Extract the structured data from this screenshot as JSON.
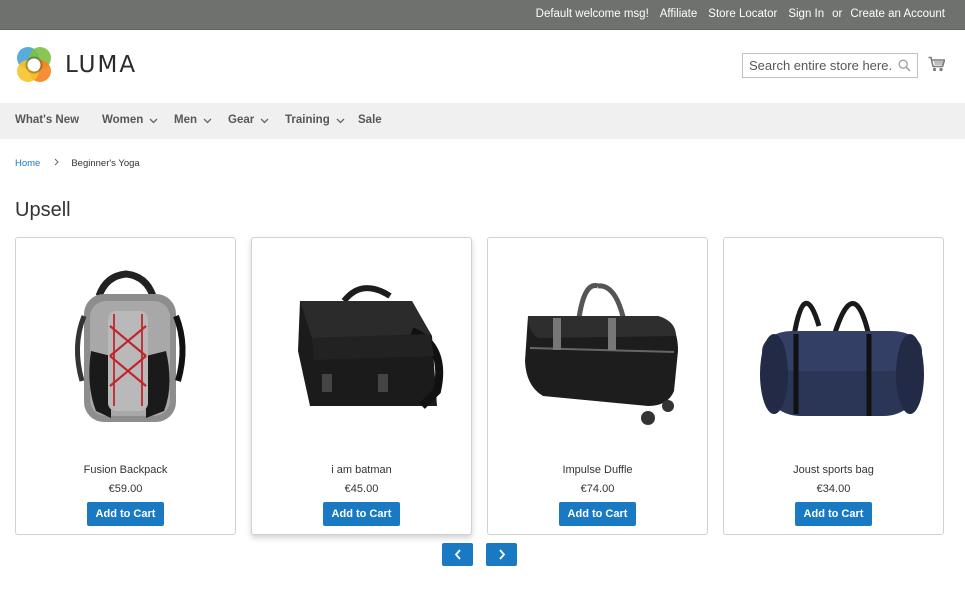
{
  "topbar": {
    "welcome": "Default welcome msg!",
    "affiliate": "Affiliate",
    "store_locator": "Store Locator",
    "sign_in": "Sign In",
    "or": "or",
    "create_account": "Create an Account"
  },
  "header": {
    "logo_text": "LUMA",
    "search_placeholder": "Search entire store here..."
  },
  "nav": {
    "items": [
      {
        "label": "What's New",
        "has_dropdown": false
      },
      {
        "label": "Women",
        "has_dropdown": true
      },
      {
        "label": "Men",
        "has_dropdown": true
      },
      {
        "label": "Gear",
        "has_dropdown": true
      },
      {
        "label": "Training",
        "has_dropdown": true
      },
      {
        "label": "Sale",
        "has_dropdown": false
      }
    ]
  },
  "breadcrumbs": {
    "home": "Home",
    "separator": "›",
    "current": "Beginner's Yoga"
  },
  "section_title": "Upsell",
  "products": [
    {
      "name": "Fusion Backpack",
      "price": "€59.00",
      "button": "Add to Cart",
      "image": "backpack-image"
    },
    {
      "name": "i am batman",
      "price": "€45.00",
      "button": "Add to Cart",
      "image": "messenger-bag-image"
    },
    {
      "name": "Impulse Duffle",
      "price": "€74.00",
      "button": "Add to Cart",
      "image": "rolling-duffle-image"
    },
    {
      "name": "Joust sports bag",
      "price": "€34.00",
      "button": "Add to Cart",
      "image": "sports-bag-image"
    }
  ],
  "colors": {
    "topbar_bg": "#6e716e",
    "accent": "#1979c3",
    "nav_bg": "#f0f0f0"
  }
}
